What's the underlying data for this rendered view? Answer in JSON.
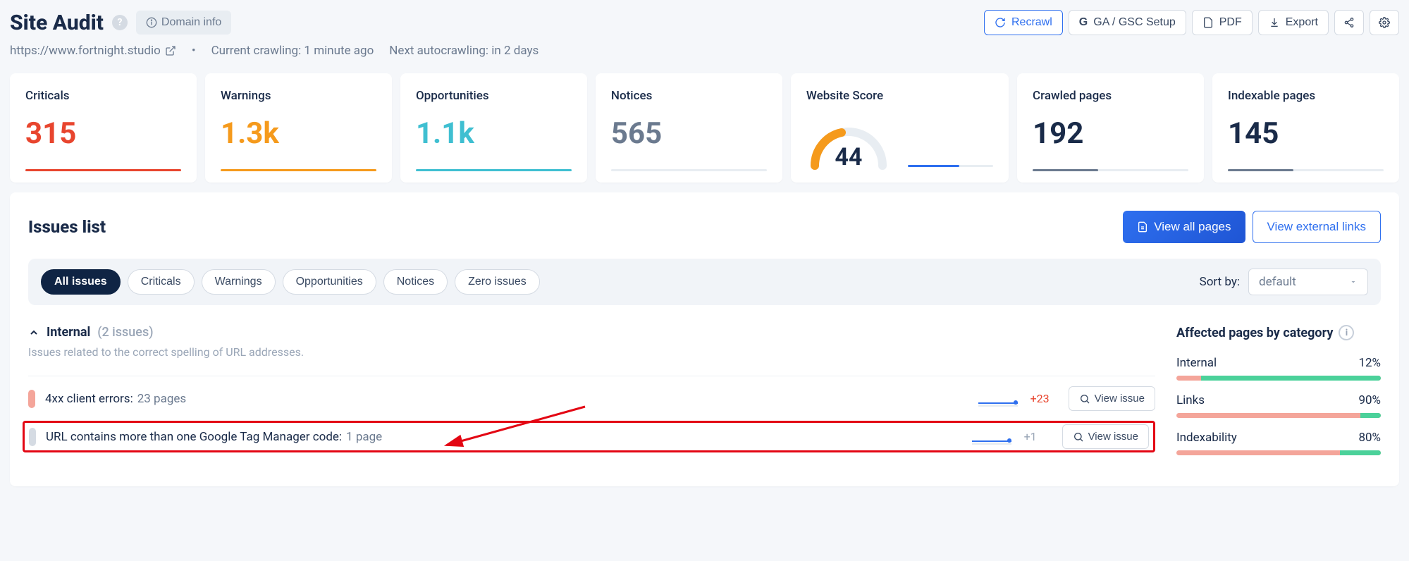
{
  "header": {
    "title": "Site Audit",
    "domain_info": "Domain info",
    "recrawl": "Recrawl",
    "ga_gsc": "GA / GSC Setup",
    "pdf": "PDF",
    "export": "Export"
  },
  "sub": {
    "url": "https://www.fortnight.studio",
    "crawl_status": "Current crawling: 1 minute ago",
    "next_crawl": "Next autocrawling: in 2 days"
  },
  "cards": {
    "criticals": {
      "label": "Criticals",
      "value": "315"
    },
    "warnings": {
      "label": "Warnings",
      "value": "1.3k"
    },
    "opportunities": {
      "label": "Opportunities",
      "value": "1.1k"
    },
    "notices": {
      "label": "Notices",
      "value": "565"
    },
    "score": {
      "label": "Website Score",
      "value": "44"
    },
    "crawled": {
      "label": "Crawled pages",
      "value": "192"
    },
    "indexable": {
      "label": "Indexable pages",
      "value": "145"
    }
  },
  "panel": {
    "title": "Issues list",
    "view_all": "View all pages",
    "view_ext": "View external links"
  },
  "filters": {
    "all": "All issues",
    "criticals": "Criticals",
    "warnings": "Warnings",
    "opportunities": "Opportunities",
    "notices": "Notices",
    "zero": "Zero issues",
    "sort_label": "Sort by:",
    "sort_value": "default"
  },
  "group": {
    "name": "Internal",
    "count": "(2 issues)",
    "desc": "Issues related to the correct spelling of URL addresses."
  },
  "issues": [
    {
      "title": "4xx client errors:",
      "pages": "23 pages",
      "delta": "+23",
      "delta_class": "red",
      "sev": "sev-red",
      "view": "View issue",
      "highlight": false
    },
    {
      "title": "URL contains more than one Google Tag Manager code:",
      "pages": "1 page",
      "delta": "+1",
      "delta_class": "gray",
      "sev": "sev-gray",
      "view": "View issue",
      "highlight": true
    }
  ],
  "side": {
    "title": "Affected pages by category",
    "cats": [
      {
        "name": "Internal",
        "pct": "12%",
        "fill": 88
      },
      {
        "name": "Links",
        "pct": "90%",
        "fill": 10
      },
      {
        "name": "Indexability",
        "pct": "80%",
        "fill": 20
      }
    ]
  }
}
